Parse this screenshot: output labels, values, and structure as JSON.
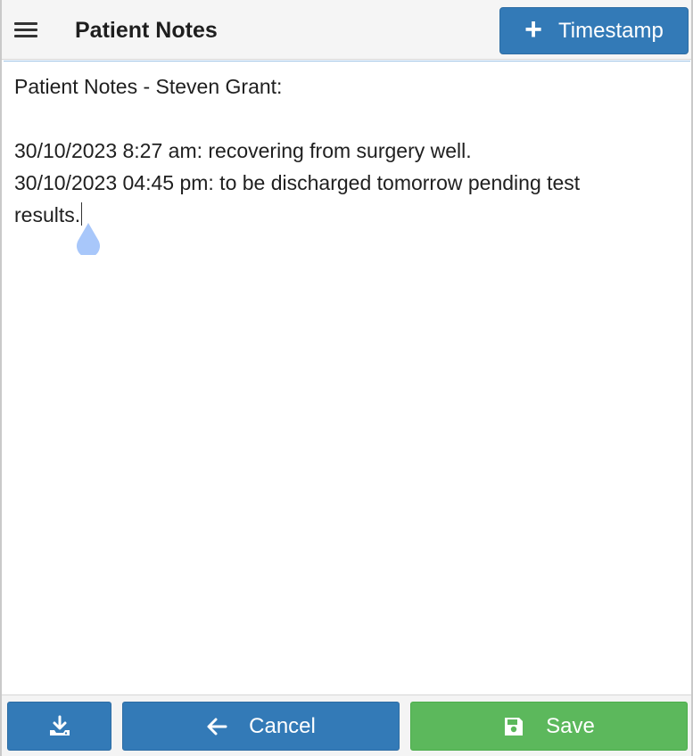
{
  "header": {
    "title": "Patient Notes",
    "menu_icon": "hamburger-menu-icon",
    "timestamp_button": {
      "icon": "plus-icon",
      "label": "Timestamp"
    }
  },
  "notes": {
    "lines": [
      "Patient Notes - Steven Grant:",
      "",
      "30/10/2023 8:27 am: recovering from surgery well.",
      "30/10/2023 04:45 pm: to be discharged tomorrow pending test",
      "results."
    ]
  },
  "footer": {
    "download_button": {
      "icon": "download-icon"
    },
    "cancel_button": {
      "icon": "arrow-left-icon",
      "label": "Cancel"
    },
    "save_button": {
      "icon": "floppy-disk-icon",
      "label": "Save"
    }
  },
  "colors": {
    "primary": "#337ab7",
    "success": "#5cb85c",
    "header_bg": "#f5f5f5",
    "caret_handle": "#a8c7fa"
  }
}
